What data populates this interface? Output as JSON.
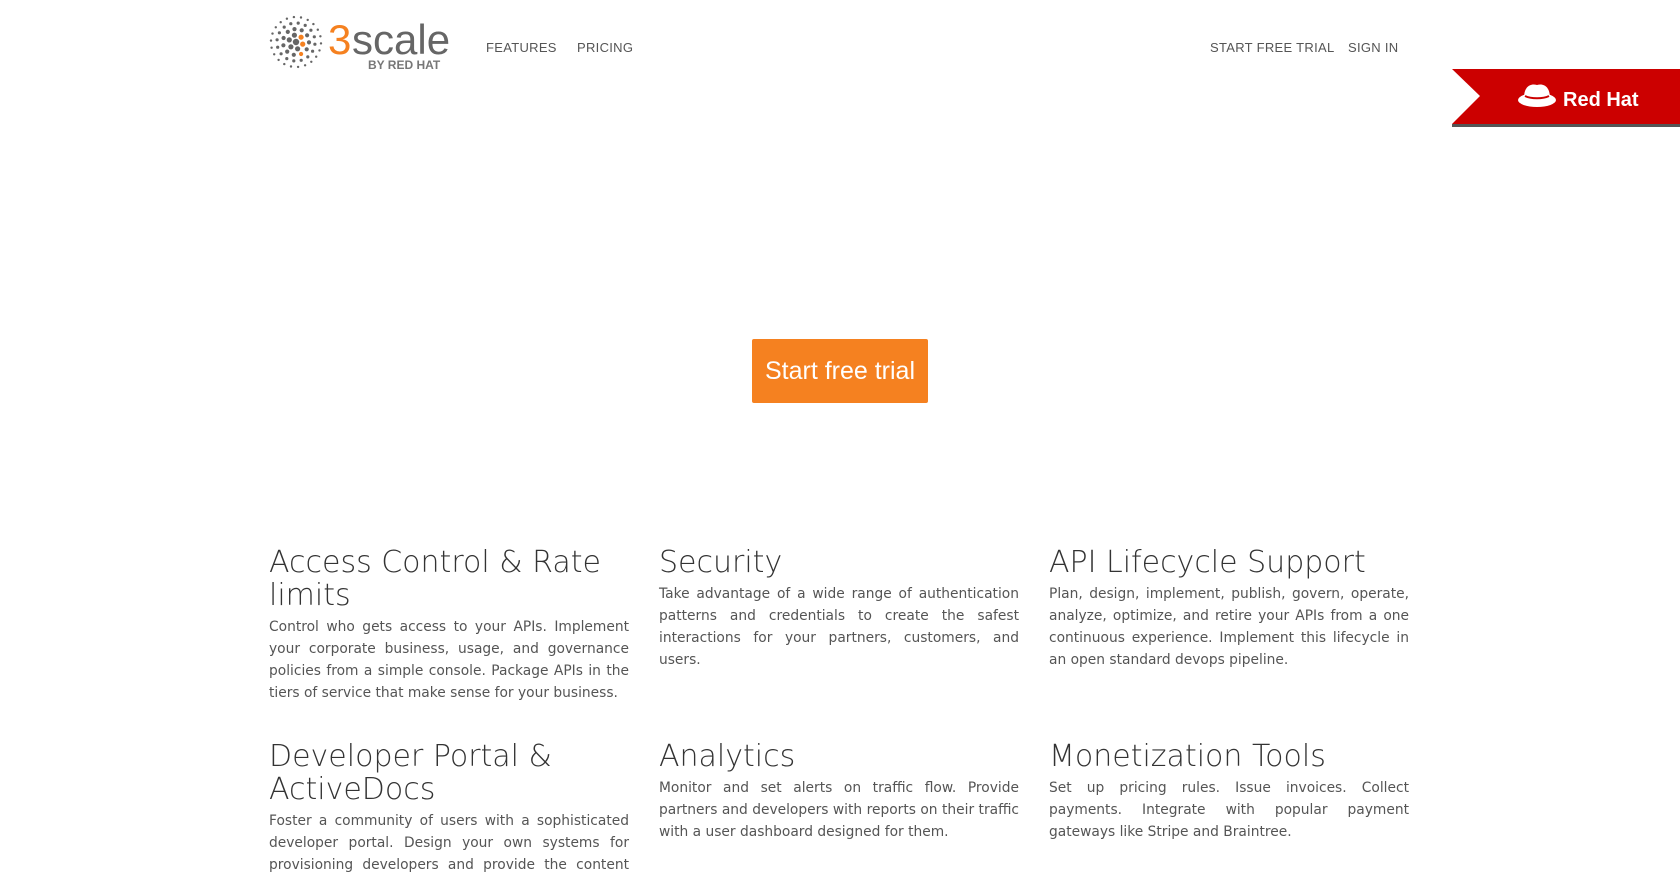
{
  "colors": {
    "accent": "#f58120",
    "redhat_red": "#cc0000",
    "text_dark": "#333333",
    "text_muted": "#555555"
  },
  "header": {
    "logo": {
      "name": "3scale",
      "tagline": "BY RED HAT"
    },
    "nav": {
      "features": "FEATURES",
      "pricing": "PRICING",
      "start_free_trial": "START FREE TRIAL",
      "sign_in": "SIGN IN"
    },
    "redhat_banner": {
      "label": "Red Hat",
      "icon": "red-hat-fedora-icon"
    }
  },
  "hero": {
    "cta_label": "Start free trial"
  },
  "features": [
    {
      "title": "Access Control & Rate limits",
      "text": "Control who gets access to your APIs. Implement your corporate business, usage, and governance policies from a simple console. Package APIs in the tiers of service that make sense for your business."
    },
    {
      "title": "Security",
      "text": "Take advantage of a wide range of authentication patterns and credentials to create the safest interactions for your partners, customers, and users."
    },
    {
      "title": "API Lifecycle Support",
      "text": "Plan, design, implement, publish, govern, operate, analyze, optimize, and retire your APIs from a one continuous experience. Implement this lifecycle in an open standard devops pipeline."
    },
    {
      "title": "Developer Portal & ActiveDocs",
      "text": "Foster a community of users with a sophisticated developer portal. Design your own systems for provisioning developers and provide the content and"
    },
    {
      "title": "Analytics",
      "text": "Monitor and set alerts on traffic flow. Provide partners and developers with reports on their traffic with a user dashboard designed for them."
    },
    {
      "title": "Monetization Tools",
      "text": "Set up pricing rules. Issue invoices. Collect payments. Integrate with popular payment gateways like Stripe and Braintree."
    }
  ]
}
